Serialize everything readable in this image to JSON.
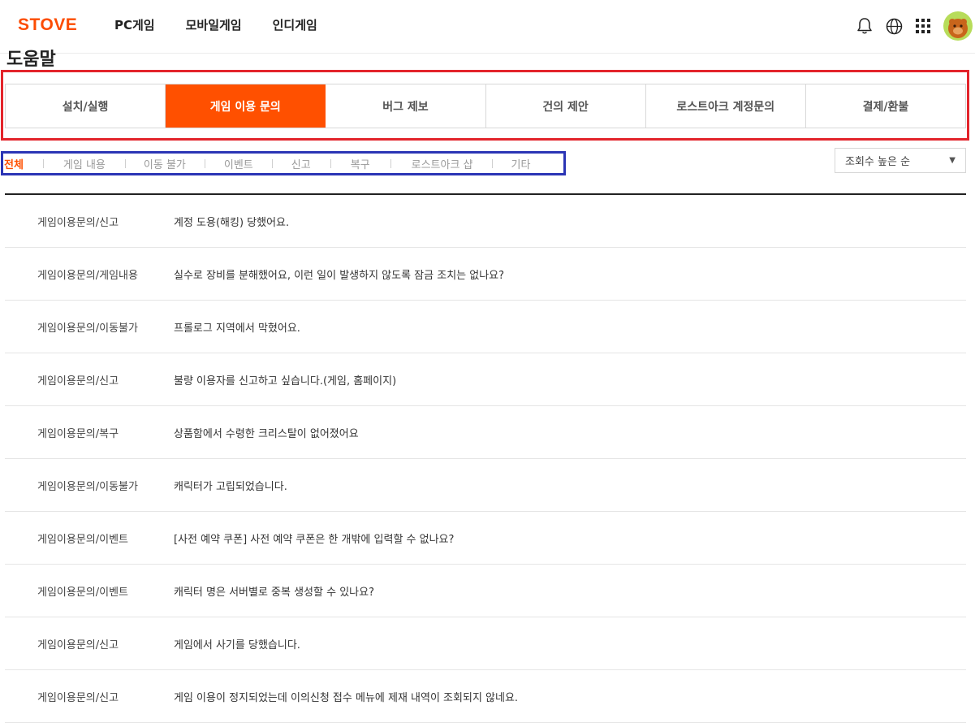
{
  "header": {
    "logo": "STOVE",
    "nav": [
      "PC게임",
      "모바일게임",
      "인디게임"
    ]
  },
  "page_title": "도움말",
  "tabs": [
    {
      "label": "설치/실행",
      "active": false
    },
    {
      "label": "게임 이용 문의",
      "active": true
    },
    {
      "label": "버그 제보",
      "active": false
    },
    {
      "label": "건의 제안",
      "active": false
    },
    {
      "label": "로스트아크 계정문의",
      "active": false
    },
    {
      "label": "결제/환불",
      "active": false
    }
  ],
  "subcategories": [
    {
      "label": "전체",
      "active": true
    },
    {
      "label": "게임 내용",
      "active": false
    },
    {
      "label": "이동 불가",
      "active": false
    },
    {
      "label": "이벤트",
      "active": false
    },
    {
      "label": "신고",
      "active": false
    },
    {
      "label": "복구",
      "active": false
    },
    {
      "label": "로스트아크 샵",
      "active": false
    },
    {
      "label": "기타",
      "active": false
    }
  ],
  "sort": {
    "selected": "조회수 높은 순"
  },
  "articles": [
    {
      "category": "게임이용문의/신고",
      "title": "계정 도용(해킹) 당했어요."
    },
    {
      "category": "게임이용문의/게임내용",
      "title": "실수로 장비를 분해했어요, 이런 일이 발생하지 않도록 잠금 조치는 없나요?"
    },
    {
      "category": "게임이용문의/이동불가",
      "title": "프롤로그 지역에서 막혔어요."
    },
    {
      "category": "게임이용문의/신고",
      "title": "불량 이용자를 신고하고 싶습니다.(게임, 홈페이지)"
    },
    {
      "category": "게임이용문의/복구",
      "title": "상품함에서 수령한 크리스탈이 없어졌어요"
    },
    {
      "category": "게임이용문의/이동불가",
      "title": "캐릭터가 고립되었습니다."
    },
    {
      "category": "게임이용문의/이벤트",
      "title": "[사전 예약 쿠폰] 사전 예약 쿠폰은 한 개밖에 입력할 수 없나요?"
    },
    {
      "category": "게임이용문의/이벤트",
      "title": "캐릭터 명은 서버별로 중복 생성할 수 있나요?"
    },
    {
      "category": "게임이용문의/신고",
      "title": "게임에서 사기를 당했습니다."
    },
    {
      "category": "게임이용문의/신고",
      "title": "게임 이용이 정지되었는데 이의신청 접수 메뉴에 제재 내역이 조회되지 않네요."
    }
  ],
  "colors": {
    "brand": "#fc4c02",
    "active_tab": "#ff5000",
    "tabs_highlight": "#e3242b",
    "subcats_highlight": "#2b35b5"
  },
  "icons": [
    "bell-icon",
    "globe-icon",
    "apps-grid-icon",
    "avatar"
  ]
}
